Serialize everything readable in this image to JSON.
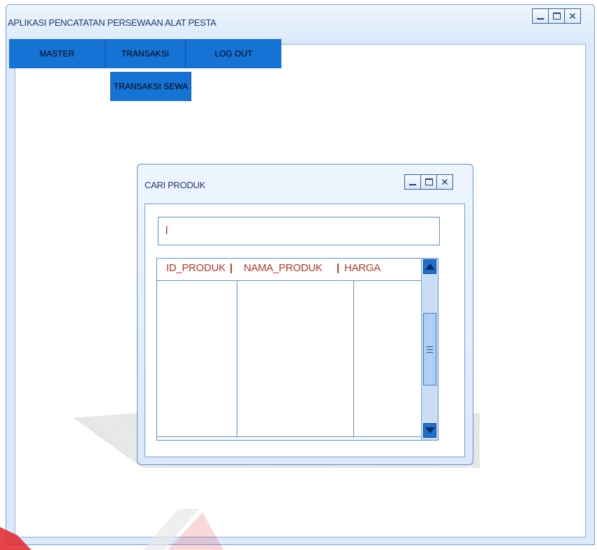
{
  "main_window": {
    "title": "APLIKASI PENCATATAN PERSEWAAN ALAT PESTA"
  },
  "menu": {
    "items": [
      {
        "label": "MASTER"
      },
      {
        "label": "TRANSAKSI"
      },
      {
        "label": "LOG OUT"
      }
    ],
    "submenu": {
      "label": "TRANSAKSI SEWA"
    }
  },
  "dialog": {
    "title": "CARI PRODUK",
    "search_value": "l",
    "columns": [
      "ID_PRODUK",
      "NAMA_PRODUK",
      "HARGA"
    ],
    "rows": []
  },
  "colors": {
    "menu_bg": "#1673d6",
    "frame_bg": "#dbe9fa",
    "header_text": "#b33a2a",
    "watermark": "#e2232a"
  },
  "icons": [
    "minimize-icon",
    "maximize-icon",
    "close-icon",
    "scroll-up-icon",
    "scroll-down-icon"
  ]
}
